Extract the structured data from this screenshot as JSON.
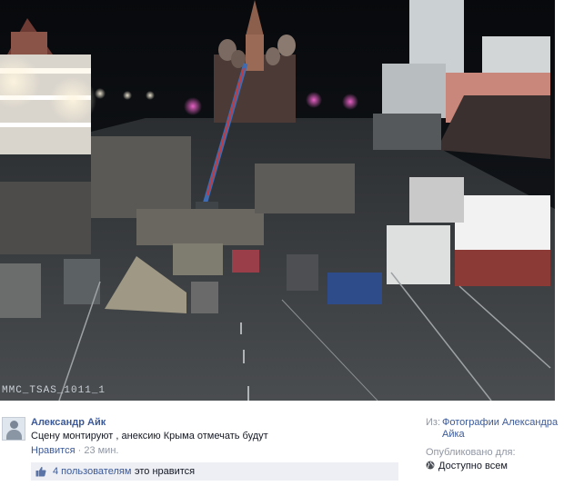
{
  "photo": {
    "camera_label": "MMC_TSAS_1011_1"
  },
  "comment": {
    "author": "Александр Айк",
    "text": "Сцену монтируют , анексию Крыма отмечать будут",
    "like_action": "Нравится",
    "separator": " · ",
    "time": "23 мин.",
    "likes_count": "4 пользователям",
    "likes_suffix": "это нравится"
  },
  "sidebar": {
    "from_label": "Из:",
    "album": "Фотографии Александра Айка",
    "published_label": "Опубликовано для:",
    "audience": "Доступно всем"
  },
  "colors": {
    "link": "#3b5998",
    "muted": "#9197a3",
    "likes_bg": "#edeff4"
  },
  "icons": [
    "avatar",
    "thumbs-up-icon",
    "globe-icon"
  ]
}
